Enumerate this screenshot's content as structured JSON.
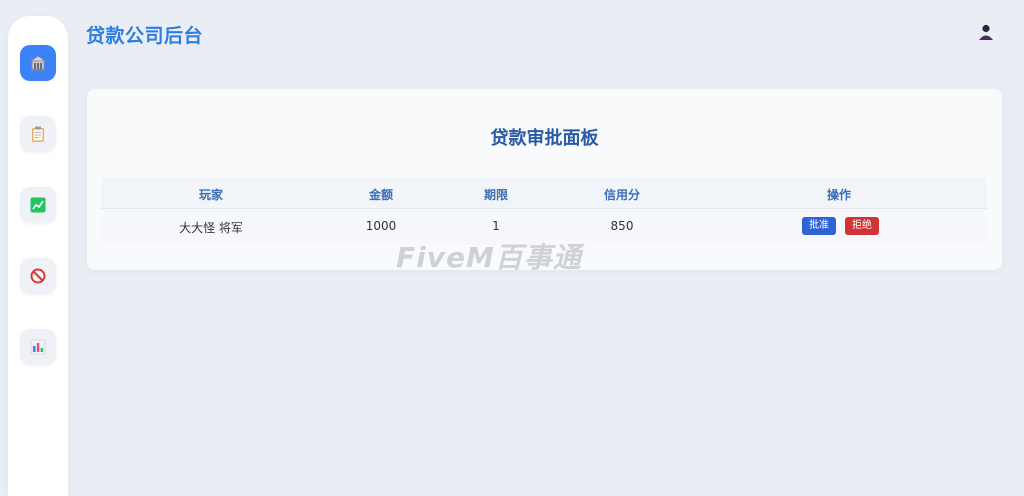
{
  "header": {
    "app_title": "贷款公司后台"
  },
  "sidebar": {
    "items": [
      {
        "icon": "bank-icon",
        "active": true
      },
      {
        "icon": "clipboard-icon",
        "active": false
      },
      {
        "icon": "chart-up-icon",
        "active": false
      },
      {
        "icon": "prohibited-icon",
        "active": false
      },
      {
        "icon": "bar-chart-icon",
        "active": false
      }
    ]
  },
  "panel": {
    "title": "贷款审批面板",
    "columns": [
      "玩家",
      "金额",
      "期限",
      "信用分",
      "操作"
    ],
    "rows": [
      {
        "player": "大大怪 将军",
        "amount": "1000",
        "term": "1",
        "credit_score": "850",
        "approve_label": "批准",
        "reject_label": "拒绝"
      }
    ]
  },
  "watermark": "FiveM百事通",
  "colors": {
    "accent": "#3b82f6",
    "title": "#2f7de1",
    "approve": "#2f63d3",
    "reject": "#d03434",
    "background": "#e9eef5"
  }
}
